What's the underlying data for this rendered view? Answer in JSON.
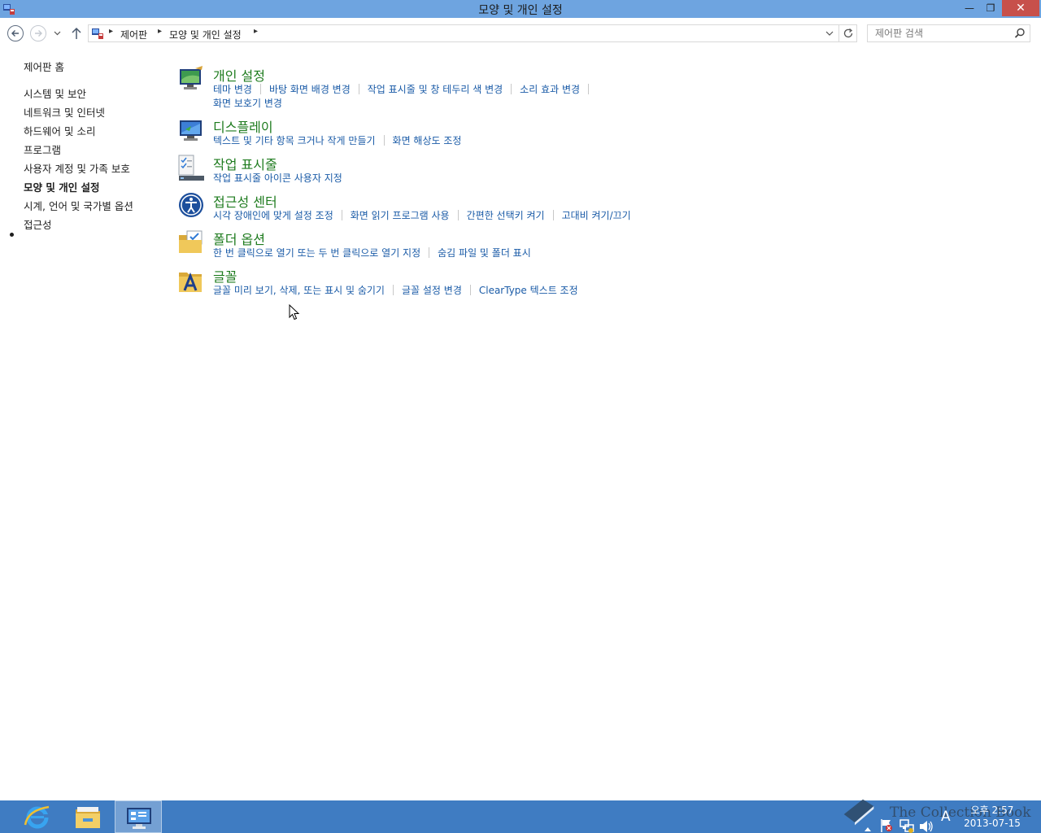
{
  "window": {
    "title": "모양 및 개인 설정",
    "minimize_label": "—",
    "maximize_label": "❐",
    "close_label": "✕"
  },
  "nav": {
    "breadcrumbs": [
      "제어판",
      "모양 및 개인 설정"
    ],
    "search_placeholder": "제어판 검색"
  },
  "sidebar": {
    "items": [
      {
        "label": "제어판 홈"
      },
      {
        "label": "시스템 및 보안"
      },
      {
        "label": "네트워크 및 인터넷"
      },
      {
        "label": "하드웨어 및 소리"
      },
      {
        "label": "프로그램"
      },
      {
        "label": "사용자 계정 및 가족 보호"
      },
      {
        "label": "모양 및 개인 설정"
      },
      {
        "label": "시계, 언어 및 국가별 옵션"
      },
      {
        "label": "접근성"
      }
    ]
  },
  "categories": [
    {
      "title": "개인 설정",
      "links": [
        "테마 변경",
        "바탕 화면 배경 변경",
        "작업 표시줄 및 창 테두리 색 변경",
        "소리 효과 변경",
        "화면 보호기 변경"
      ]
    },
    {
      "title": "디스플레이",
      "links": [
        "텍스트 및 기타 항목 크거나 작게 만들기",
        "화면 해상도 조정"
      ]
    },
    {
      "title": "작업 표시줄",
      "links": [
        "작업 표시줄 아이콘 사용자 지정"
      ]
    },
    {
      "title": "접근성 센터",
      "links": [
        "시각 장애인에 맞게 설정 조정",
        "화면 읽기 프로그램 사용",
        "간편한 선택키 켜기",
        "고대비 켜기/끄기"
      ]
    },
    {
      "title": "폴더 옵션",
      "links": [
        "한 번 클릭으로 열기 또는 두 번 클릭으로 열기 지정",
        "숨김 파일 및 폴더 표시"
      ]
    },
    {
      "title": "글꼴",
      "links": [
        "글꼴 미리 보기, 삭제, 또는 표시 및 숨기기",
        "글꼴 설정 변경",
        "ClearType 텍스트 조정"
      ]
    }
  ],
  "taskbar": {
    "time": "오후 2:57",
    "date": "2013-07-15",
    "ime_label": "A",
    "watermark": "The Collection Book"
  }
}
